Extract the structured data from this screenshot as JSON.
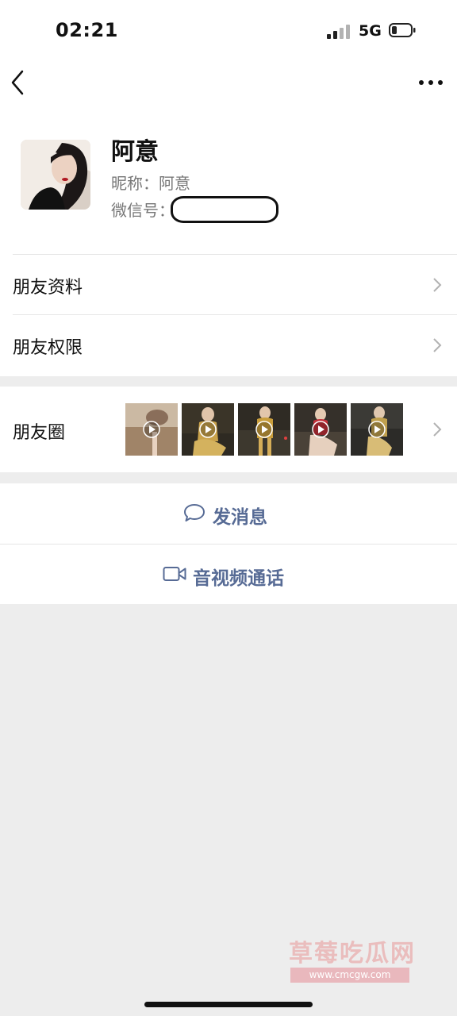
{
  "status_bar": {
    "time": "02:21",
    "network": "5G",
    "battery_level": 0.25
  },
  "nav": {
    "back_icon": "chevron-left-icon",
    "more_icon": "ellipsis-icon"
  },
  "profile": {
    "name": "阿意",
    "nickname_line": "昵称：阿意",
    "wechat_id_label": "微信号："
  },
  "rows": {
    "friend_info": "朋友资料",
    "friend_permissions": "朋友权限",
    "moments": "朋友圈"
  },
  "actions": {
    "send_message": "发消息",
    "video_call": "音视频通话"
  },
  "watermark": {
    "title": "草莓吃瓜网",
    "url": "www.cmcgw.com"
  },
  "colors": {
    "link_blue": "#576b95",
    "page_gray": "#ededed",
    "chevron_gray": "#b2b2b2"
  }
}
